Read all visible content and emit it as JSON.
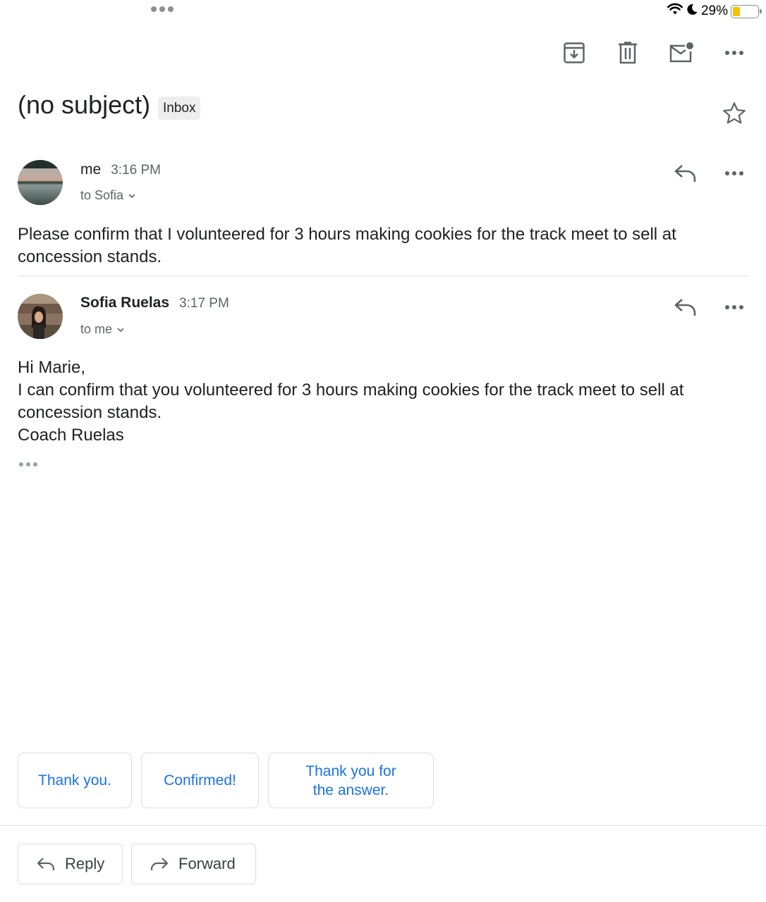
{
  "status_bar": {
    "battery_percent": "29%",
    "battery_level": 0.29,
    "icons": [
      "wifi-icon",
      "moon-icon",
      "battery-icon"
    ]
  },
  "toolbar": {
    "icons": [
      "archive-icon",
      "delete-icon",
      "mark-unread-icon",
      "more-options-icon"
    ]
  },
  "thread": {
    "subject": "(no subject)",
    "label": "Inbox",
    "starred": false
  },
  "messages": [
    {
      "sender": "me",
      "time": "3:16 PM",
      "recipient": "to Sofia",
      "body": [
        "Please confirm that I volunteered for 3 hours making cookies for the track meet to sell at concession stands."
      ]
    },
    {
      "sender": "Sofia Ruelas",
      "time": "3:17 PM",
      "recipient": "to me",
      "body": [
        "Hi Marie,",
        "I can confirm that you volunteered for 3 hours making cookies for the track meet to sell at concession stands.",
        "Coach Ruelas"
      ]
    }
  ],
  "smart_replies": [
    "Thank you.",
    "Confirmed!",
    "Thank you for the answer."
  ],
  "actions": {
    "reply": "Reply",
    "forward": "Forward"
  },
  "colors": {
    "accent": "#1a73e8",
    "text": "#202124",
    "secondary_text": "#5f6368",
    "battery": "#f5c400"
  }
}
